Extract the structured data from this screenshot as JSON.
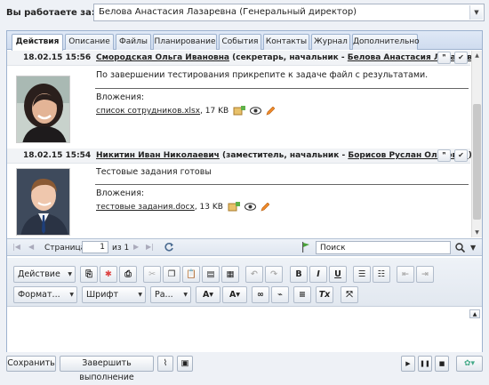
{
  "header": {
    "label": "Вы работаете за:",
    "selected_user": "Белова Анастасия Лазаревна (Генеральный директор)"
  },
  "tabs": [
    {
      "label": "Действия",
      "active": true
    },
    {
      "label": "Описание"
    },
    {
      "label": "Файлы"
    },
    {
      "label": "Планирование"
    },
    {
      "label": "События"
    },
    {
      "label": "Контакты"
    },
    {
      "label": "Журнал"
    },
    {
      "label": "Дополнительно"
    }
  ],
  "messages": [
    {
      "date": "18.02.15 15:56",
      "author": "Смородская Ольга Ивановна",
      "role": " (секретарь, начальник - ",
      "recipient": "Белова Анастасия Лазаревна",
      "role_end": ")",
      "text": "По завершении тестирования прикрепите к задаче файл с результатами.",
      "attachments_label": "Вложения:",
      "file_name": "список сотрудников.xlsx",
      "file_size": ", 17 KB"
    },
    {
      "date": "18.02.15 15:54",
      "author": "Никитин Иван Николаевич",
      "role": " (заместитель, начальник - ",
      "recipient": "Борисов Руслан Олегович",
      "role_end": ")",
      "text": "Тестовые задания готовы",
      "attachments_label": "Вложения:",
      "file_name": "тестовые задания.docx",
      "file_size": ", 13 KB"
    }
  ],
  "pager": {
    "page_label": "Страница",
    "page_value": "1",
    "of_label": "из 1",
    "search_placeholder": "Поиск"
  },
  "editor_toolbar": {
    "action": "Действие",
    "format": "Формат...",
    "font": "Шрифт",
    "size": "Ра..."
  },
  "footer": {
    "save": "Сохранить",
    "complete": "Завершить выполнение"
  },
  "colors": {
    "panel_border": "#9db2cf",
    "background": "#eef1f6"
  }
}
